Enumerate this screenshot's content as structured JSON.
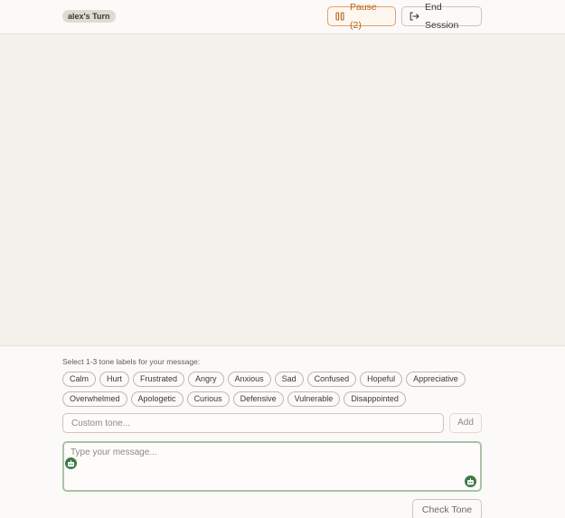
{
  "header": {
    "turn_label": "alex's Turn",
    "pause_label": "Pause (2)",
    "pause_icon": "pause-icon",
    "end_session_label": "End Session",
    "end_session_icon": "logout-icon"
  },
  "composer": {
    "tone_prompt": "Select 1-3 tone labels for your message:",
    "tones_row1": [
      "Calm",
      "Hurt",
      "Frustrated",
      "Angry",
      "Anxious",
      "Sad",
      "Confused",
      "Hopeful",
      "Appreciative"
    ],
    "tones_row2": [
      "Overwhelmed",
      "Apologetic",
      "Curious",
      "Defensive",
      "Vulnerable",
      "Disappointed"
    ],
    "custom_tone_placeholder": "Custom tone...",
    "add_label": "Add",
    "message_placeholder": "Type your message...",
    "check_tone_label": "Check Tone",
    "assistant_icon": "robot-icon"
  },
  "colors": {
    "accent_orange": "#b8651f",
    "focus_green": "#a9c3a5",
    "bot_green": "#3f7a48"
  }
}
